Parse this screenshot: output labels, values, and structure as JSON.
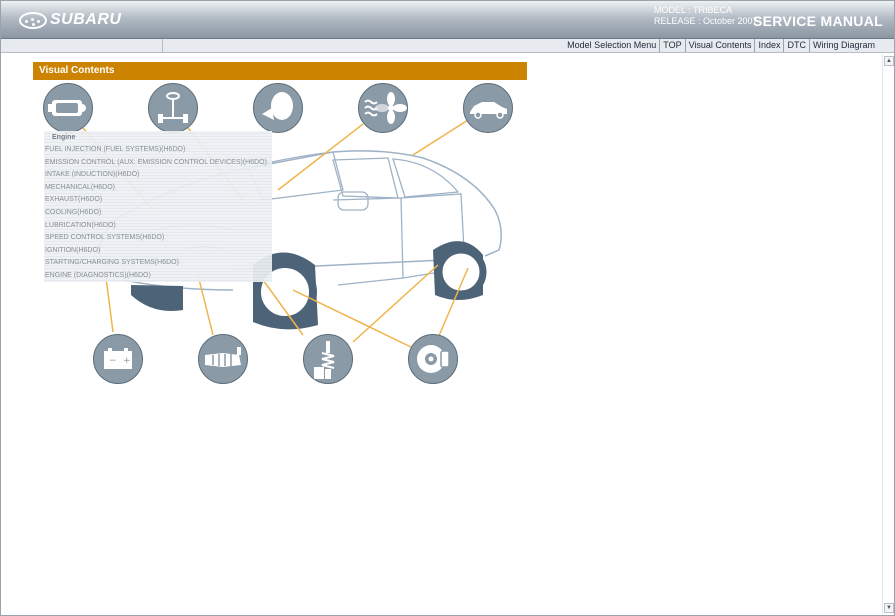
{
  "header": {
    "logo_text": "SUBARU",
    "model_line": "MODEL : TRIBECA",
    "release_line": "RELEASE : October 2007",
    "title": "SERVICE MANUAL"
  },
  "nav": {
    "links": [
      "Model Selection Menu",
      "TOP",
      "Visual Contents",
      "Index",
      "DTC",
      "Wiring Diagram"
    ]
  },
  "visual_contents": {
    "title": "Visual Contents",
    "top_icons": [
      "engine-icon",
      "steering-icon",
      "airbag-icon",
      "hvac-fan-icon",
      "body-icon"
    ],
    "bottom_icons": [
      "battery-icon",
      "transmission-icon",
      "suspension-icon",
      "brake-icon"
    ]
  },
  "engine_menu": {
    "title": "Engine",
    "items": [
      "FUEL INJECTION (FUEL SYSTEMS)(H6DO)",
      "EMISSION CONTROL (AUX. EMISSION CONTROL DEVICES)(H6DO)",
      "INTAKE (INDUCTION)(H6DO)",
      "MECHANICAL(H6DO)",
      "EXHAUST(H6DO)",
      "COOLING(H6DO)",
      "LUBRICATION(H6DO)",
      "SPEED CONTROL SYSTEMS(H6DO)",
      "IGNITION(H6DO)",
      "STARTING/CHARGING SYSTEMS(H6DO)",
      "ENGINE (DIAGNOSTICS)(H6DO)"
    ]
  },
  "colors": {
    "accent": "#cc8400",
    "leader_line": "#f0b44a",
    "icon_bg": "#8a9aa7",
    "car_outline": "#9fb3c6",
    "tire": "#4d6478"
  }
}
